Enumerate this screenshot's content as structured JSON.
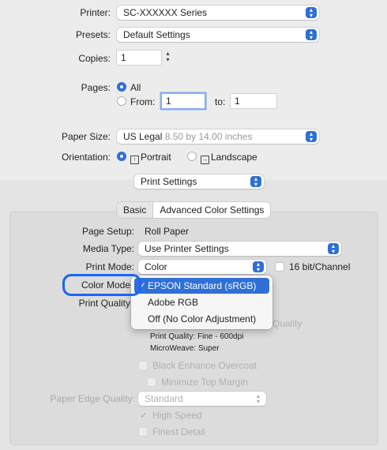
{
  "printer": {
    "label": "Printer:",
    "value": "SC-XXXXXX Series"
  },
  "presets": {
    "label": "Presets:",
    "value": "Default Settings"
  },
  "copies": {
    "label": "Copies:",
    "value": "1"
  },
  "pages": {
    "label": "Pages:",
    "all_label": "All",
    "from_label": "From:",
    "from_value": "1",
    "to_label": "to:",
    "to_value": "1"
  },
  "paper_size": {
    "label": "Paper Size:",
    "value": "US Legal",
    "dims": "8.50 by 14.00 inches"
  },
  "orientation": {
    "label": "Orientation:",
    "portrait": "Portrait",
    "landscape": "Landscape"
  },
  "section_popup": {
    "value": "Print Settings"
  },
  "tabs": [
    {
      "label": "Basic"
    },
    {
      "label": "Advanced Color Settings"
    }
  ],
  "page_setup": {
    "label": "Page Setup:",
    "value": "Roll Paper"
  },
  "media_type": {
    "label": "Media Type:",
    "value": "Use Printer Settings"
  },
  "print_mode": {
    "label": "Print Mode:",
    "value": "Color",
    "bit_label": "16 bit/Channel"
  },
  "color_mode": {
    "label": "Color Mode"
  },
  "print_quality": {
    "label": "Print Quality",
    "partial": "Quality",
    "info_quality": "Print Quality: Fine - 600dpi",
    "info_microweave": "MicroWeave: Super"
  },
  "color_menu": {
    "items": [
      {
        "label": "EPSON Standard (sRGB)",
        "checkmark": "✓"
      },
      {
        "label": "Adobe RGB",
        "checkmark": ""
      },
      {
        "label": "Off (No Color Adjustment)",
        "checkmark": ""
      }
    ]
  },
  "black_enhance": {
    "label": "Black Enhance Overcoat"
  },
  "minimize_margin": {
    "label": "Minimize Top Margin"
  },
  "paper_edge": {
    "label": "Paper Edge Quality:",
    "value": "Standard"
  },
  "high_speed": {
    "label": "High Speed",
    "checkmark": "✓"
  },
  "finest_detail": {
    "label": "Finest Detail"
  },
  "colors": {
    "accent": "#2f6fd6",
    "callout": "#1a66f5"
  }
}
